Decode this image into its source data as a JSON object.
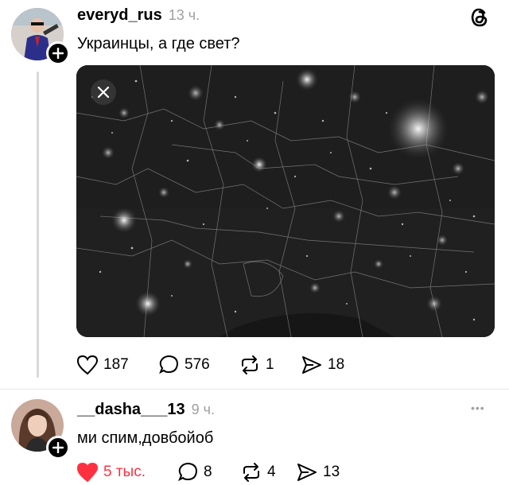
{
  "post": {
    "username": "everyd_rus",
    "time": "13 ч.",
    "text": "Украинцы, а где свет?",
    "likes": "187",
    "comments": "576",
    "reposts": "1",
    "shares": "18"
  },
  "reply": {
    "username": "__dasha___13",
    "time": "9 ч.",
    "text": "ми спим,довбойоб",
    "likes": "5 тыс.",
    "comments": "8",
    "reposts": "4",
    "shares": "13",
    "more": "•••"
  },
  "colors": {
    "like_red": "#ff3040",
    "muted": "#a0a0a0",
    "line": "#d9d9d9"
  }
}
